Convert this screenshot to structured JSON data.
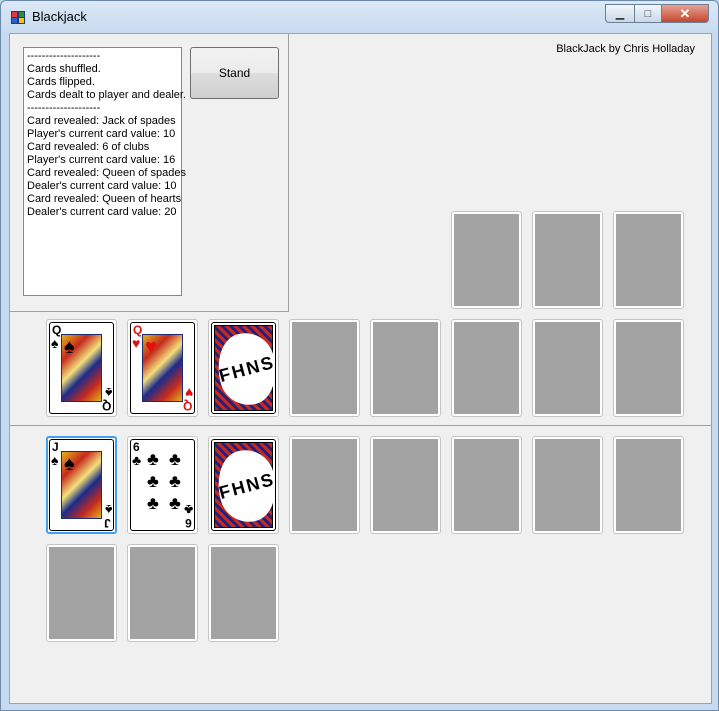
{
  "window": {
    "title": "Blackjack",
    "minimize_glyph": "▁",
    "maximize_glyph": "□",
    "close_glyph": "✕"
  },
  "log_lines": [
    "--------------------",
    "Cards shuffled.",
    "Cards flipped.",
    "Cards dealt to player and dealer.",
    "--------------------",
    "Card revealed: Jack of spades",
    "Player's current card value: 10",
    "Card revealed: 6 of clubs",
    "Player's current card value: 16",
    "Card revealed: Queen of spades",
    "Dealer's current card value: 10",
    "Card revealed: Queen of hearts",
    "Dealer's current card value: 20"
  ],
  "stand_label": "Stand",
  "credit": "BlackJack by Chris Holladay",
  "back_text": "FHNS",
  "dealer_cards": [
    {
      "rank": "Q",
      "suit": "♠",
      "color": "black"
    },
    {
      "rank": "Q",
      "suit": "♥",
      "color": "red"
    },
    {
      "back": true
    }
  ],
  "player_cards": [
    {
      "rank": "J",
      "suit": "♠",
      "color": "black",
      "selected": true
    },
    {
      "rank": "6",
      "suit": "♣",
      "color": "black"
    },
    {
      "back": true
    }
  ],
  "colors": {
    "empty_slot": "#a3a3a3",
    "selection": "#3fa0f0",
    "red_suit": "#e01010"
  }
}
